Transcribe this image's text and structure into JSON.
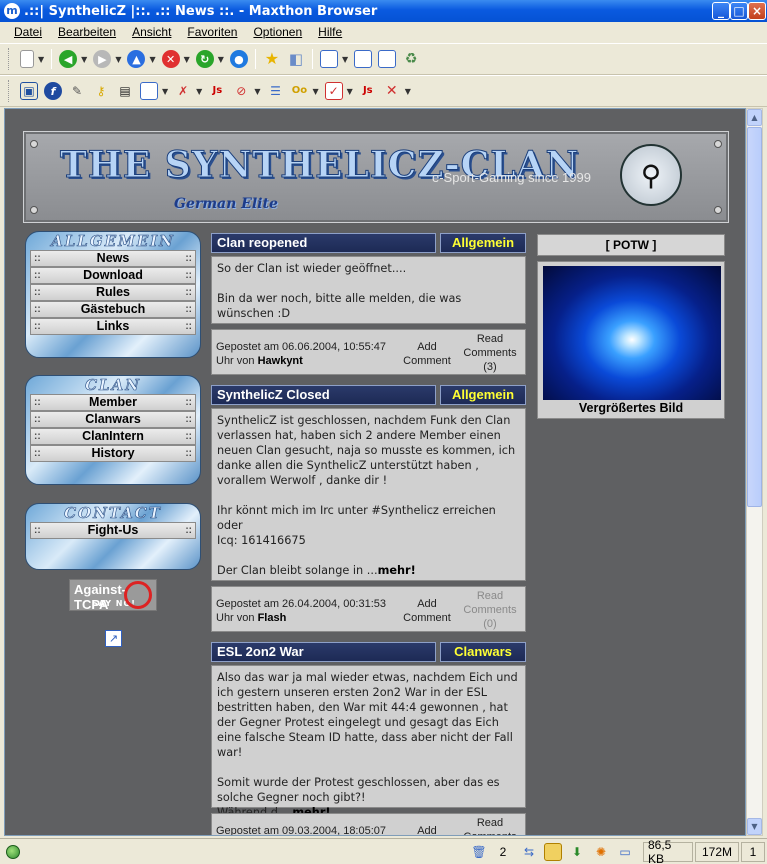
{
  "window": {
    "title": ".::| SynthelicZ |::. .:: News ::. - Maxthon Browser"
  },
  "menu": [
    "Datei",
    "Bearbeiten",
    "Ansicht",
    "Favoriten",
    "Optionen",
    "Hilfe"
  ],
  "banner": {
    "clan_name": "THE SYNTHELICZ-CLAN",
    "subtitle": "German Elite",
    "tagline": "e-Sport-Gaming since 1999"
  },
  "sidebar": {
    "allgemein": {
      "heading": "ALLGEMEIN",
      "items": [
        "News",
        "Download",
        "Rules",
        "Gästebuch",
        "Links"
      ]
    },
    "clan": {
      "heading": "CLAN",
      "items": [
        "Member",
        "Clanwars",
        "ClanIntern",
        "History"
      ]
    },
    "contact": {
      "heading": "CONTACT",
      "items": [
        "Fight-Us"
      ]
    },
    "badge": {
      "title": "Against-TCPA",
      "subtitle": "SAY NO!"
    }
  },
  "news": [
    {
      "title": "Clan reopened",
      "category": "Allgemein",
      "body": "So der Clan ist wieder geöffnet....\n\nBin da wer noch, bitte alle melden, die was wünschen :D",
      "posted": "Gepostet am 06.06.2004, 10:55:47",
      "author_prefix": "Uhr von ",
      "author": "Hawkynt",
      "add_comment": "Add\nComment",
      "read_comments": "Read\nComments\n(3)"
    },
    {
      "title": "SynthelicZ Closed",
      "category": "Allgemein",
      "body": "SynthelicZ ist geschlossen, nachdem Funk den Clan verlassen hat, haben sich 2 andere Member einen neuen Clan gesucht, naja so musste es kommen, ich danke allen die SynthelicZ unterstützt haben , vorallem Werwolf , danke dir !\n\nIhr könnt mich im Irc unter #Synthelicz erreichen\noder\nIcq: 161416675\n\nDer Clan bleibt solange in ...",
      "more": "mehr!",
      "posted": "Gepostet am 26.04.2004, 00:31:53",
      "author_prefix": "Uhr von ",
      "author": "Flash",
      "add_comment": "Add\nComment",
      "read_comments": "Read\nComments\n(0)"
    },
    {
      "title": "ESL 2on2 War",
      "category": "Clanwars",
      "body": "Also das war ja mal wieder etwas, nachdem Eich und ich gestern unseren ersten 2on2 War in der ESL bestritten haben, den War mit 44:4 gewonnen , hat der Gegner Protest eingelegt und gesagt das Eich eine falsche Steam ID hatte, dass aber nicht der Fall war!\n\nSomit wurde der Protest geschlossen, aber das es solche Gegner noch gibt?!\nWährend d ...",
      "more": "mehr!",
      "posted": "Gepostet am 09.03.2004, 18:05:07",
      "add_comment": "Add",
      "read_comments": "Read\nComments"
    }
  ],
  "potw": {
    "heading": "[ POTW ]",
    "caption": "Vergrößertes Bild"
  },
  "status": {
    "count": "2",
    "size": "86,5 KB",
    "memory": "172M",
    "page": "1"
  }
}
